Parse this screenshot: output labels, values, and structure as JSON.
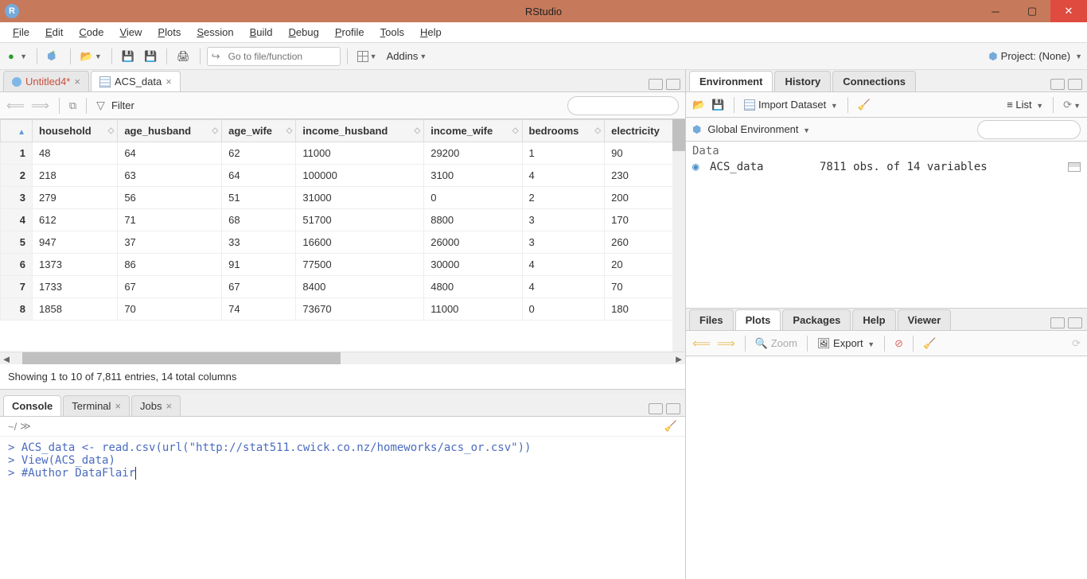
{
  "window": {
    "title": "RStudio"
  },
  "menubar": {
    "items": [
      {
        "label": "File",
        "u": "F",
        "rest": "ile"
      },
      {
        "label": "Edit",
        "u": "E",
        "rest": "dit"
      },
      {
        "label": "Code",
        "u": "C",
        "rest": "ode"
      },
      {
        "label": "View",
        "u": "V",
        "rest": "iew"
      },
      {
        "label": "Plots",
        "u": "P",
        "rest": "lots"
      },
      {
        "label": "Session",
        "u": "S",
        "rest": "ession"
      },
      {
        "label": "Build",
        "u": "B",
        "rest": "uild"
      },
      {
        "label": "Debug",
        "u": "D",
        "rest": "ebug"
      },
      {
        "label": "Profile",
        "u": "P",
        "rest": "rofile"
      },
      {
        "label": "Tools",
        "u": "T",
        "rest": "ools"
      },
      {
        "label": "Help",
        "u": "H",
        "rest": "elp"
      }
    ]
  },
  "toolbar": {
    "goto_placeholder": "Go to file/function",
    "addins": "Addins",
    "project_label": "Project: (None)"
  },
  "source_pane": {
    "tabs": [
      {
        "label": "Untitled4*",
        "unsaved": true
      },
      {
        "label": "ACS_data",
        "unsaved": false
      }
    ],
    "filter_label": "Filter",
    "columns": [
      "household",
      "age_husband",
      "age_wife",
      "income_husband",
      "income_wife",
      "bedrooms",
      "electricity"
    ],
    "rows": [
      {
        "n": "1",
        "cells": [
          "48",
          "64",
          "62",
          "11000",
          "29200",
          "1",
          "90"
        ]
      },
      {
        "n": "2",
        "cells": [
          "218",
          "63",
          "64",
          "100000",
          "3100",
          "4",
          "230"
        ]
      },
      {
        "n": "3",
        "cells": [
          "279",
          "56",
          "51",
          "31000",
          "0",
          "2",
          "200"
        ]
      },
      {
        "n": "4",
        "cells": [
          "612",
          "71",
          "68",
          "51700",
          "8800",
          "3",
          "170"
        ]
      },
      {
        "n": "5",
        "cells": [
          "947",
          "37",
          "33",
          "16600",
          "26000",
          "3",
          "260"
        ]
      },
      {
        "n": "6",
        "cells": [
          "1373",
          "86",
          "91",
          "77500",
          "30000",
          "4",
          "20"
        ]
      },
      {
        "n": "7",
        "cells": [
          "1733",
          "67",
          "67",
          "8400",
          "4800",
          "4",
          "70"
        ]
      },
      {
        "n": "8",
        "cells": [
          "1858",
          "70",
          "74",
          "73670",
          "11000",
          "0",
          "180"
        ]
      }
    ],
    "status": "Showing 1 to 10 of 7,811 entries, 14 total columns"
  },
  "console_pane": {
    "tabs": [
      "Console",
      "Terminal",
      "Jobs"
    ],
    "path": "~/",
    "lines": [
      {
        "prompt": ">",
        "text": " ACS_data <- read.csv(url(\"http://stat511.cwick.co.nz/homeworks/acs_or.csv\"))"
      },
      {
        "prompt": ">",
        "text": " View(ACS_data)"
      },
      {
        "prompt": ">",
        "text": " #Author DataFlair"
      }
    ]
  },
  "env_pane": {
    "tabs": [
      "Environment",
      "History",
      "Connections"
    ],
    "import_label": "Import Dataset",
    "list_label": "List",
    "scope": "Global Environment",
    "section": "Data",
    "items": [
      {
        "name": "ACS_data",
        "desc": "7811 obs. of 14 variables"
      }
    ]
  },
  "files_pane": {
    "tabs": [
      "Files",
      "Plots",
      "Packages",
      "Help",
      "Viewer"
    ],
    "zoom": "Zoom",
    "export": "Export"
  }
}
